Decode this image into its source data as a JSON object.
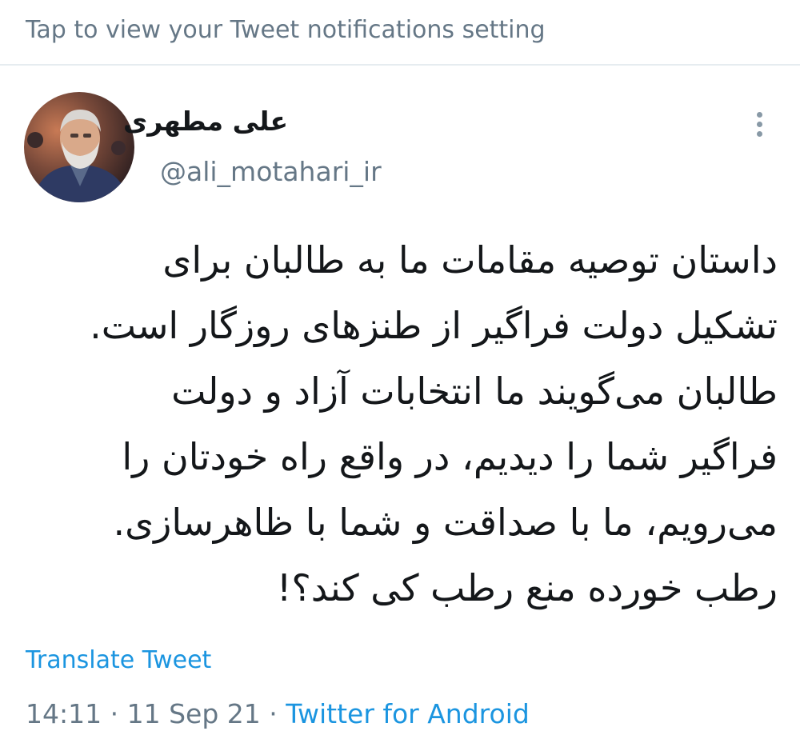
{
  "banner": {
    "text": "Tap to view your Tweet notifications setting"
  },
  "author": {
    "display_name": "علی مطهری",
    "handle": "@ali_motahari_ir",
    "avatar_icon": "profile-photo"
  },
  "tweet": {
    "lines": [
      "داستان توصیه مقامات ما به طالبان برای",
      "تشکیل دولت فراگیر از طنزهای روزگار است.",
      "طالبان می‌گویند ما انتخابات آزاد و دولت",
      "فراگیر شما را دیدیم، در واقع راه خودتان را",
      "می‌رویم، ما با صداقت و شما با ظاهرسازی.",
      "رطب خورده منع رطب کی کند؟!"
    ],
    "translate_label": "Translate Tweet"
  },
  "meta": {
    "time": "14:11",
    "separator": "·",
    "date": "11 Sep 21",
    "source": "Twitter for Android"
  },
  "colors": {
    "link": "#1b95e0",
    "muted": "#657786",
    "text": "#14171a"
  }
}
